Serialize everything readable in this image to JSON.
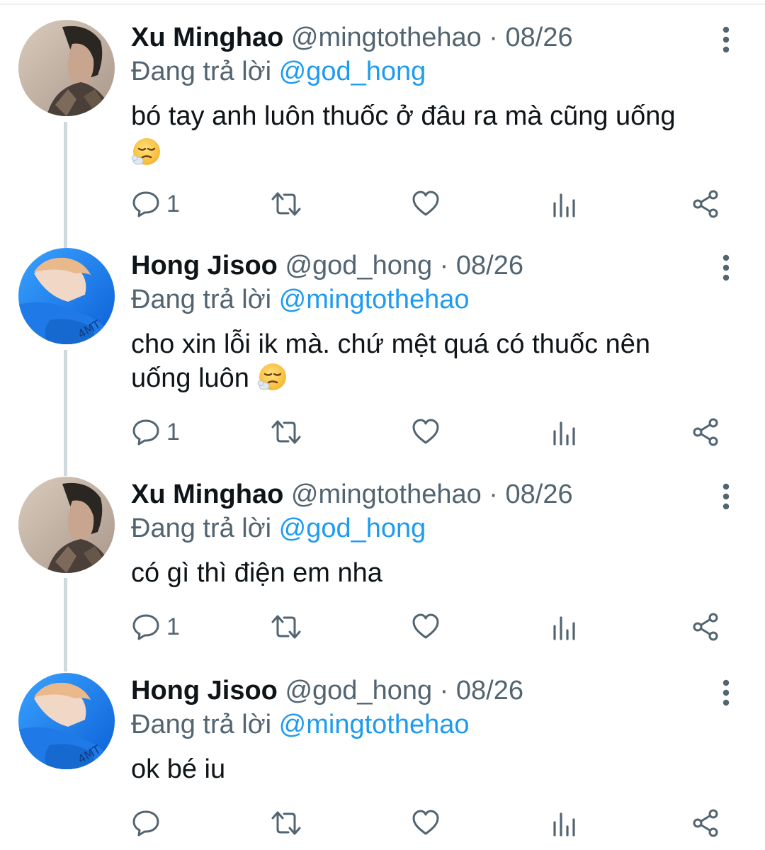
{
  "colors": {
    "name": "#0f1419",
    "muted": "#536471",
    "mention": "#1d9bf0",
    "thread_line": "#cfd9de"
  },
  "tweets": [
    {
      "author": "Xu Minghao",
      "handle": "@mingtothehao",
      "separator": "·",
      "date": "08/26",
      "reply_prefix": "Đang trả lời",
      "reply_to": "@god_hong",
      "text": "bó tay anh luôn thuốc ở đâu ra mà cũng uống",
      "emoji": "face-exhaling",
      "reply_count": "1",
      "avatar": "avatar-minghao"
    },
    {
      "author": "Hong Jisoo",
      "handle": "@god_hong",
      "separator": "·",
      "date": "08/26",
      "reply_prefix": "Đang trả lời",
      "reply_to": "@mingtothehao",
      "text_line1": "cho xin lỗi ik mà. chứ mệt quá có thuốc nên",
      "text_line2": "uống luôn",
      "emoji": "face-exhaling",
      "reply_count": "1",
      "avatar": "avatar-jisoo"
    },
    {
      "author": "Xu Minghao",
      "handle": "@mingtothehao",
      "separator": "·",
      "date": "08/26",
      "reply_prefix": "Đang trả lời",
      "reply_to": "@god_hong",
      "text": "có gì thì điện em nha",
      "reply_count": "1",
      "avatar": "avatar-minghao"
    },
    {
      "author": "Hong Jisoo",
      "handle": "@god_hong",
      "separator": "·",
      "date": "08/26",
      "reply_prefix": "Đang trả lời",
      "reply_to": "@mingtothehao",
      "text": "ok bé iu",
      "reply_count": "",
      "avatar": "avatar-jisoo"
    }
  ],
  "action_icons": [
    "reply-icon",
    "retweet-icon",
    "like-icon",
    "analytics-icon",
    "share-icon"
  ]
}
